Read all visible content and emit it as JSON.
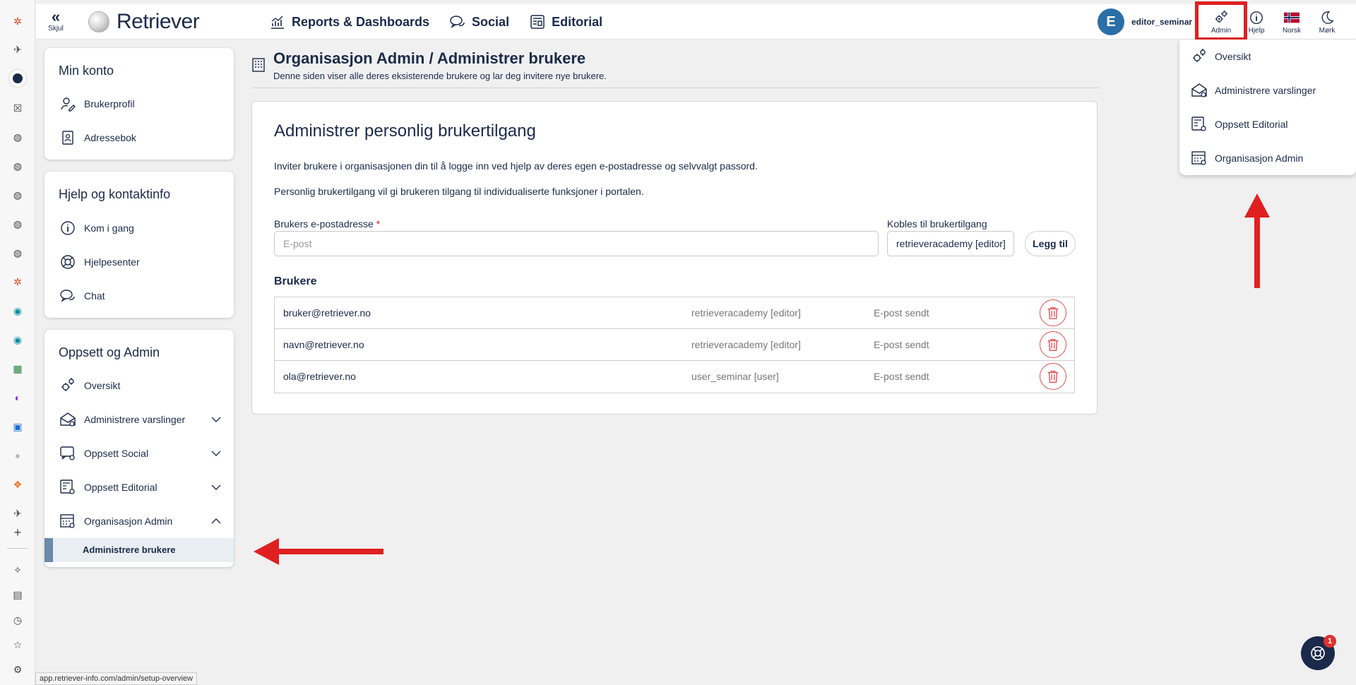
{
  "topbar": {
    "hide_label": "Skjul",
    "logo_text": "Retriever",
    "nav": [
      {
        "label": "Reports & Dashboards",
        "icon": "chart-icon"
      },
      {
        "label": "Social",
        "icon": "chat-icon"
      },
      {
        "label": "Editorial",
        "icon": "newspaper-icon"
      }
    ],
    "user_initial": "E",
    "username": "editor_seminar",
    "tools": {
      "admin": "Admin",
      "help": "Hjelp",
      "language": "Norsk",
      "theme": "Mørk"
    }
  },
  "sidebar": {
    "account": {
      "title": "Min konto",
      "items": [
        {
          "label": "Brukerprofil",
          "icon": "user-edit-icon"
        },
        {
          "label": "Adressebok",
          "icon": "address-book-icon"
        }
      ]
    },
    "help": {
      "title": "Hjelp og kontaktinfo",
      "items": [
        {
          "label": "Kom i gang",
          "icon": "info-icon"
        },
        {
          "label": "Hjelpesenter",
          "icon": "lifebuoy-icon"
        },
        {
          "label": "Chat",
          "icon": "chat-bubbles-icon"
        }
      ]
    },
    "setup": {
      "title": "Oppsett og Admin",
      "items": [
        {
          "label": "Oversikt",
          "icon": "gears-icon"
        },
        {
          "label": "Administrere varslinger",
          "icon": "envelope-gear-icon"
        },
        {
          "label": "Oppsett Social",
          "icon": "social-gear-icon"
        },
        {
          "label": "Oppsett Editorial",
          "icon": "editorial-gear-icon"
        },
        {
          "label": "Organisasjon Admin",
          "icon": "org-gear-icon"
        }
      ],
      "active_sub": "Administrere brukere"
    }
  },
  "main": {
    "title": "Organisasjon Admin / Administrer brukere",
    "subtitle": "Denne siden viser alle deres eksisterende brukere og lar deg invitere nye brukere.",
    "panel": {
      "heading": "Administrer personlig brukertilgang",
      "para1": "Inviter brukere i organisasjonen din til å logge inn ved hjelp av deres egen e-postadresse og selvvalgt passord.",
      "para2": "Personlig brukertilgang vil gi brukeren tilgang til individualiserte funksjoner i portalen.",
      "email_label": "Brukers e-postadresse",
      "email_required": "*",
      "email_placeholder": "E-post",
      "access_label": "Kobles til brukertilgang",
      "access_value": "retrieveracademy [editor]",
      "add_button": "Legg til",
      "users_heading": "Brukere",
      "users": [
        {
          "email": "bruker@retriever.no",
          "access": "retrieveracademy [editor]",
          "status": "E-post sendt"
        },
        {
          "email": "navn@retriever.no",
          "access": "retrieveracademy [editor]",
          "status": "E-post sendt"
        },
        {
          "email": "ola@retriever.no",
          "access": "user_seminar [user]",
          "status": "E-post sendt"
        }
      ]
    }
  },
  "admin_dropdown": [
    {
      "label": "Oversikt",
      "icon": "gears-icon"
    },
    {
      "label": "Administrere varslinger",
      "icon": "envelope-gear-icon"
    },
    {
      "label": "Oppsett Editorial",
      "icon": "editorial-gear-icon"
    },
    {
      "label": "Organisasjon Admin",
      "icon": "org-gear-icon"
    }
  ],
  "chat_badge": "1",
  "status_url": "app.retriever-info.com/admin/setup-overview",
  "colors": {
    "navy": "#1b2a4a",
    "highlight_red": "#e02020",
    "avatar_blue": "#2a6fa8"
  }
}
